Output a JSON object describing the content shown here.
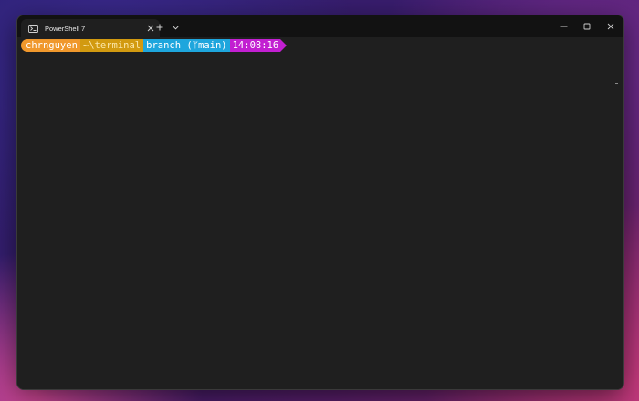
{
  "tab": {
    "title": "PowerShell 7",
    "icon": "powershell-icon"
  },
  "titlebar": {
    "new_tab": "+",
    "icons": [
      "close-icon",
      "plus-icon",
      "chevron-down-icon",
      "minimize-icon",
      "maximize-icon",
      "close-icon"
    ]
  },
  "prompt": {
    "user": "chrnguyen",
    "path": "~\\terminal",
    "git": "branch (ᛘmain)",
    "time": "14:08:16"
  },
  "colors": {
    "user_bg": "#f0982c",
    "path_bg": "#d29a10",
    "git_bg": "#1ea6dd",
    "time_bg": "#c21fd1",
    "terminal_bg": "#1f1f1f",
    "titlebar_bg": "#121212"
  }
}
